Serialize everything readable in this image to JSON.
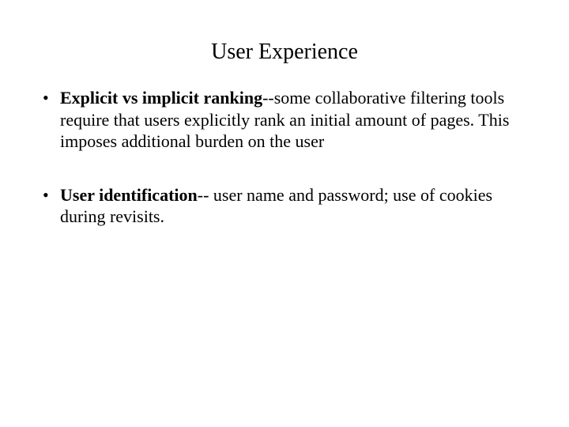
{
  "title": "User Experience",
  "bullets": [
    {
      "bold": "Explicit vs implicit ranking",
      "rest": "--some collaborative filtering tools require that users explicitly rank an initial amount of pages. This imposes additional burden on the user"
    },
    {
      "bold": "User identification",
      "rest": "-- user name and password; use of cookies during revisits."
    }
  ]
}
